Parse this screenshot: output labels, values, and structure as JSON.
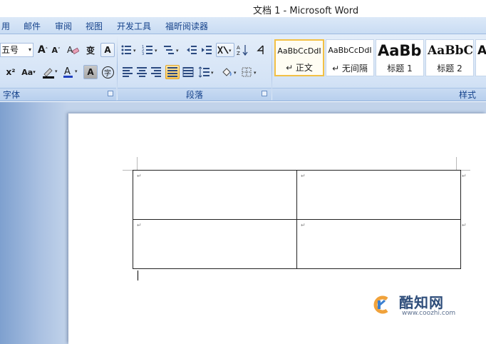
{
  "window": {
    "title": "文档 1 - Microsoft Word"
  },
  "menu": [
    "用",
    "邮件",
    "审阅",
    "视图",
    "开发工具",
    "福昕阅读器"
  ],
  "font_group": {
    "label": "字体",
    "font_size": "五号",
    "buttons": {
      "grow": "A",
      "shrink": "A",
      "clear": "A",
      "phonetic": "变",
      "border": "A",
      "superscript": "x²",
      "case": "Aa",
      "color": "A",
      "shade": "A",
      "enclose": "字"
    }
  },
  "paragraph_group": {
    "label": "段落"
  },
  "styles_group": {
    "label": "样式",
    "items": [
      {
        "sample": "AaBbCcDdI",
        "name": "↵ 正文",
        "selected": true
      },
      {
        "sample": "AaBbCcDdI",
        "name": "↵ 无间隔",
        "selected": false
      },
      {
        "sample": "AaBb",
        "name": "标题 1",
        "selected": false
      },
      {
        "sample": "AaBbC",
        "name": "标题 2",
        "selected": false
      },
      {
        "sample": "A",
        "name": "",
        "selected": false
      }
    ]
  },
  "document": {
    "table": {
      "rows": 2,
      "cols": 2,
      "cell_mark": "↵",
      "row_end_mark": "↵"
    }
  },
  "watermark": {
    "brand": "酷知网",
    "url": "www.coozhi.com"
  },
  "colors": {
    "ribbon": "#d4e3f6",
    "accent": "#15428b",
    "selected_border": "#f2c045",
    "workspace": "#c2d3ea"
  }
}
